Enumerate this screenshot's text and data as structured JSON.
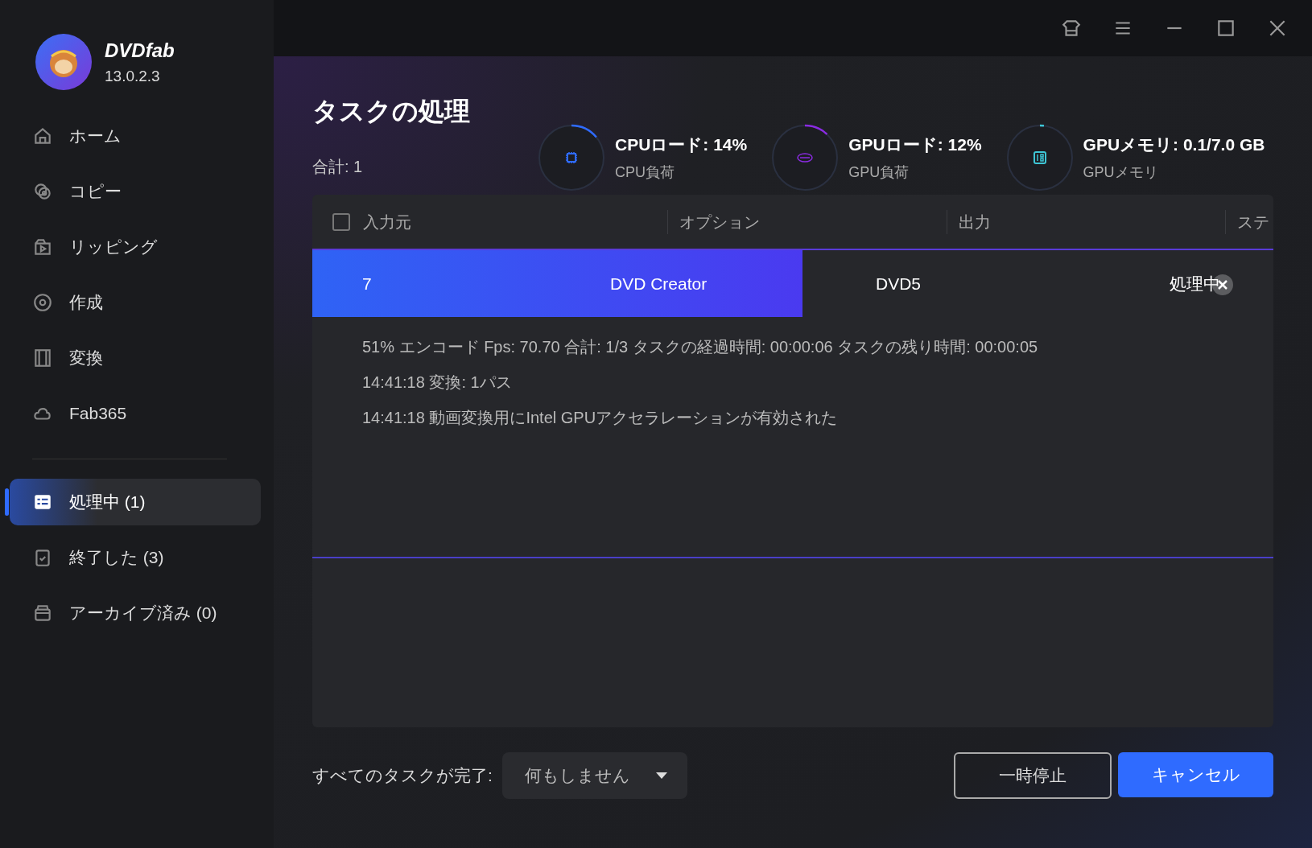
{
  "app": {
    "name": "DVDfab",
    "version": "13.0.2.3"
  },
  "sidebar": {
    "items": [
      {
        "label": "ホーム",
        "selected": false
      },
      {
        "label": "コピー",
        "selected": false
      },
      {
        "label": "リッピング",
        "selected": false
      },
      {
        "label": "作成",
        "selected": false
      },
      {
        "label": "変換",
        "selected": false
      },
      {
        "label": "Fab365",
        "selected": false
      }
    ],
    "queue_items": [
      {
        "label": "処理中 (1)",
        "selected": true
      },
      {
        "label": "終了した (3)",
        "selected": false
      },
      {
        "label": "アーカイブ済み (0)",
        "selected": false
      }
    ]
  },
  "page": {
    "title": "タスクの処理",
    "total": "合計: 1"
  },
  "gauges": [
    {
      "title": "CPUロード: 14%",
      "subtitle": "CPU負荷",
      "color": "#2f6bff",
      "level": 0.14
    },
    {
      "title": "GPUロード: 12%",
      "subtitle": "GPU負荷",
      "color": "#8a2be2",
      "level": 0.12
    },
    {
      "title": "GPUメモリ: 0.1/7.0 GB",
      "subtitle": "GPUメモリ",
      "color": "#3ec6d6",
      "level": 0.02
    }
  ],
  "table": {
    "select_all_checked": false,
    "columns": [
      "入力元",
      "オプション",
      "出力",
      "ステ"
    ],
    "rows": [
      {
        "cells": [
          "7",
          "DVD Creator",
          "DVD5",
          "処理中"
        ],
        "level": 0.51,
        "log": [
          "51%  エンコード Fps: 70.70   合計: 1/3  タスクの経過時間: 00:00:06  タスクの残り時間: 00:00:05",
          "14:41:18  変換: 1パス",
          "14:41:18  動画変換用にIntel GPUアクセラレーションが有効された"
        ]
      }
    ]
  },
  "footer": {
    "label": "すべてのタスクが完了:",
    "dropdown": "何もしません",
    "buttons": [
      {
        "label": "一時停止",
        "kind": "outline"
      },
      {
        "label": "キャンセル",
        "kind": "primary"
      }
    ]
  }
}
